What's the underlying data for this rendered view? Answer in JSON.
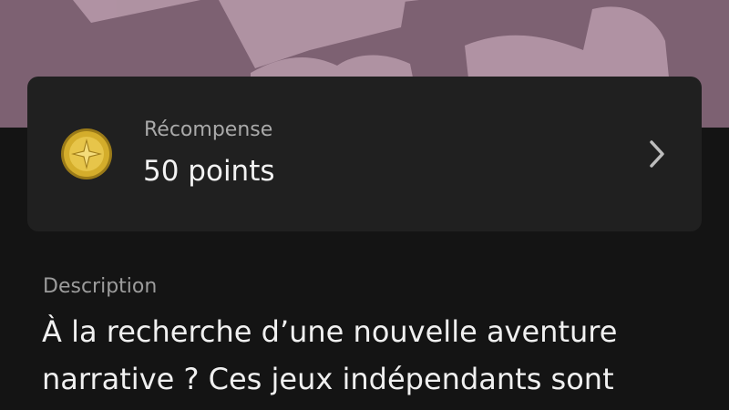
{
  "reward": {
    "label": "Récompense",
    "value": "50 points",
    "icon": "star-coin-icon",
    "chevron_icon": "chevron-right-icon"
  },
  "description": {
    "label": "Description",
    "lines": [
      "À la recherche d’une nouvelle aventure",
      "narrative ? Ces jeux indépendants sont"
    ]
  },
  "colors": {
    "banner": "#7d6172",
    "page_background": "#141414",
    "card_background": "#202020",
    "coin_gold": "#d4ad2b"
  }
}
